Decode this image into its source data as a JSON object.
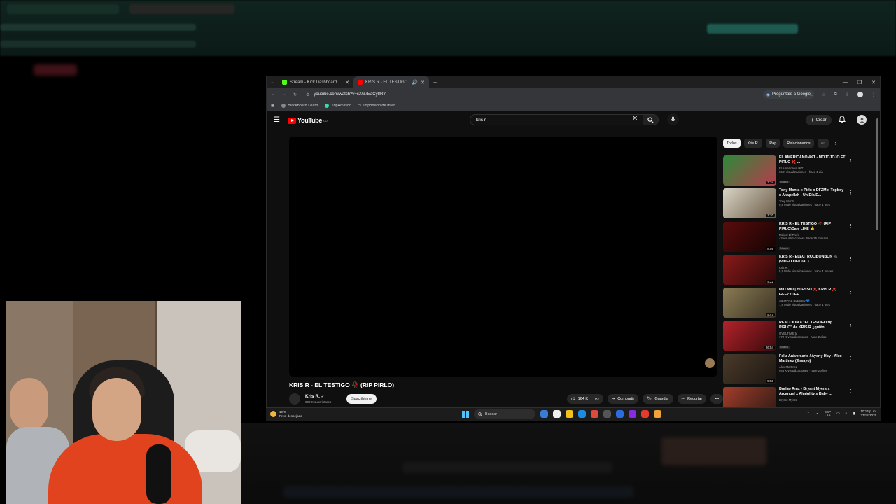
{
  "browser": {
    "tabs": [
      {
        "label": "Stream - Kick Dashboard",
        "color": "#53fc18"
      },
      {
        "label": "KRIS R - EL TESTIGO 🥀 (RI",
        "color": "#ff0000"
      }
    ],
    "url": "youtube.com/watch?v=sXG7EaCy8RY",
    "ask_google": "Pregúntale a Google",
    "bookmarks": [
      {
        "label": "Blackboard Learn",
        "icon": "blackboard-icon",
        "color": "#888888"
      },
      {
        "label": "TripAdvisor",
        "icon": "tripadvisor-icon",
        "color": "#34e0a1"
      },
      {
        "label": "Importado de Inter...",
        "icon": "folder-icon",
        "color": "#cccccc"
      }
    ]
  },
  "youtube": {
    "logo_text": "YouTube",
    "logo_region": "CO",
    "search_value": "kris r",
    "create_label": "Crear",
    "video": {
      "title": "KRIS R - EL TESTIGO 🥀 (RIP PIRLO)",
      "channel": "Kris R.",
      "subscribers": "600 K suscriptores",
      "subscribe_label": "Suscribirme",
      "likes": "164 K",
      "share_label": "Compartir",
      "save_label": "Guardar",
      "clip_label": "Recortar"
    },
    "chips": [
      "Todos",
      "Kris R.",
      "Rap",
      "Relacionados",
      "Ar"
    ],
    "recommendations": [
      {
        "title": "EL AMERICANO 4KT - MOJOJOJO FT. PIRLO ❌ ...",
        "channel": "El Americano 4KT",
        "views": "66 K visualizaciones · hace 1 día",
        "badge": "Nuevo",
        "duration": "3:34",
        "thumb": [
          "#2c8a3a",
          "#b83a4b"
        ]
      },
      {
        "title": "Tony Monta x Pirlo x DFZM x Topboy x Akapellah - Un Día E...",
        "channel": "Tony Monta",
        "views": "9,8 M de visualizaciones · hace 1 mes",
        "badge": "",
        "duration": "7:20",
        "thumb": [
          "#d9d4c6",
          "#6b5a45"
        ]
      },
      {
        "title": "KRIS R - EL TESTIGO 🥀 (RIP PIRLO)Dale LIKE 👍",
        "channel": "Maicol El Prefe",
        "views": "43 visualizaciones · hace 35 minutos",
        "badge": "Nuevo",
        "duration": "8:59",
        "thumb": [
          "#5a0c0c",
          "#140303"
        ]
      },
      {
        "title": "KRIS R - ELECTROLIBONBON 🔌 (VIDEO OFICIAL)",
        "channel": "Kris R.",
        "views": "8,8 M de visualizaciones · hace 4 meses",
        "badge": "",
        "duration": "4:22",
        "thumb": [
          "#8a1a1a",
          "#2a0808"
        ]
      },
      {
        "title": "MIU MIU | BLESSD ❌ KRIS R ❌ GEEZYDEE ...",
        "channel": "SIEMPRE BLESSD 💙",
        "views": "7,6 M de visualizaciones · hace 1 mes",
        "badge": "",
        "duration": "5:47",
        "thumb": [
          "#8a7b55",
          "#3a3222"
        ]
      },
      {
        "title": "REACCION a \"EL TESTIGO rip PIRLO\" de KRIS R ¿quién ...",
        "channel": "OVELTIME tv",
        "views": "170 K visualizaciones · hace 2 días",
        "badge": "Nuevo",
        "duration": "26:54",
        "thumb": [
          "#b3232a",
          "#3a0a0d"
        ]
      },
      {
        "title": "Feliz Aniversario / Ayer y Hoy - Alex Martinez (Ensayo)",
        "channel": "Alex Martinez",
        "views": "946 K visualizaciones · hace 2 años",
        "badge": "",
        "duration": "5:53",
        "thumb": [
          "#4a3a2a",
          "#1d1712"
        ]
      },
      {
        "title": "Burlao Rmx - Bryant Myers x Arcangel x Almighty x Baby ...",
        "channel": "Bryant Myers",
        "views": "",
        "badge": "",
        "duration": "",
        "thumb": [
          "#a33d2a",
          "#2a1a14"
        ]
      }
    ]
  },
  "taskbar": {
    "temp": "19°C",
    "weather": "Prec. despejado",
    "search_placeholder": "Buscar",
    "lang_top": "ESP",
    "lang_bottom": "LAA",
    "time": "10:14 p. m.",
    "date": "27/12/2025",
    "apps": [
      "#3a7bd5",
      "#f0f0f0",
      "#f4c21b",
      "#1c8be0",
      "#e04a3b",
      "#555555",
      "#2d6cdf",
      "#8a2be2",
      "#e33b2e",
      "#f2a33a"
    ]
  }
}
